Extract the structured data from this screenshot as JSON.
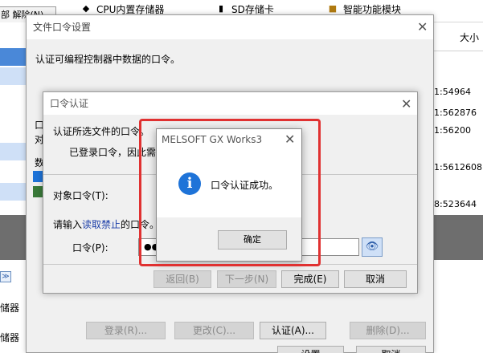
{
  "background_app": {
    "tab_label": "部 解除(N)",
    "media_items": [
      {
        "label": "CPU内置存储器",
        "icon": "cpu-memory-icon"
      },
      {
        "label": "SD存储卡",
        "icon": "sd-card-icon"
      },
      {
        "label": "智能功能模块",
        "icon": "intelligent-module-icon"
      }
    ],
    "size_column_header": "大小",
    "rows": [
      {
        "time": "1:54",
        "size": "964"
      },
      {
        "time": "1:56",
        "size": "2876"
      },
      {
        "time": "1:56",
        "size": "200"
      },
      {
        "time": "1:56",
        "size": "12608"
      },
      {
        "time": "8:52",
        "size": "3644"
      }
    ],
    "left_labels": {
      "store1": "储器",
      "store2": "储器"
    }
  },
  "file_password_dialog": {
    "title": "文件口令设置",
    "description": "认证可编程控制器中数据的口令。",
    "partial_labels": [
      "口",
      "对",
      "数"
    ],
    "buttons": {
      "login": "登录(R)...",
      "change": "更改(C)...",
      "authenticate": "认证(A)...",
      "delete": "删除(D)...",
      "settings": "设置",
      "cancel": "取消"
    }
  },
  "password_auth_dialog": {
    "title": "口令认证",
    "instruction": "认证所选文件的口令。",
    "registered_text": "已登录口令，因此需",
    "target_label": "对象口令(T):",
    "input_prompt_prefix": "请输入",
    "input_prompt_link": "读取禁止",
    "input_prompt_suffix": "的口令。",
    "password_label": "口令(P):",
    "password_value": "●●",
    "buttons": {
      "back": "返回(B)",
      "next": "下一步(N)",
      "finish": "完成(E)",
      "cancel": "取消"
    }
  },
  "message_box": {
    "title": "MELSOFT GX Works3",
    "message": "口令认证成功。",
    "ok": "确定",
    "icon": "info-icon"
  },
  "colors": {
    "highlight_border": "#e03131",
    "info_icon": "#1e73d8",
    "link_text": "#1a3da8",
    "selection_row": "#cfe0f7"
  }
}
